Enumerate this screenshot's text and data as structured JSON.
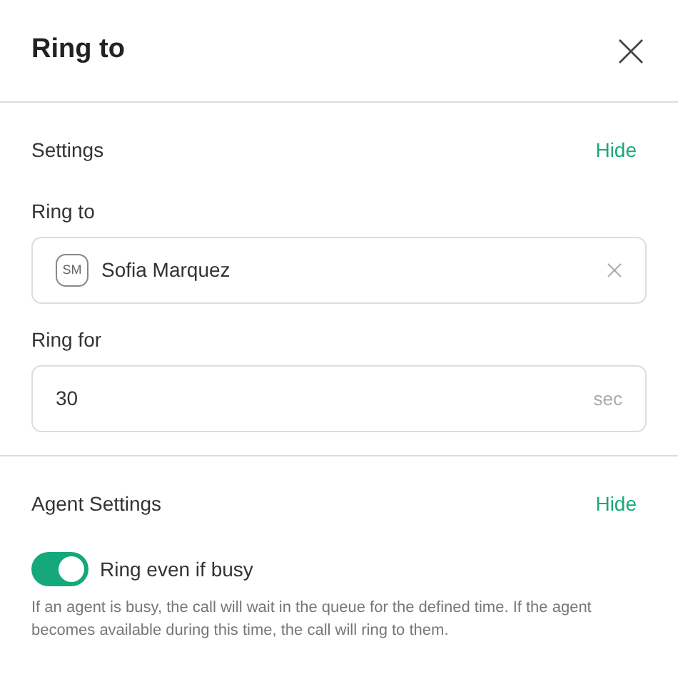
{
  "window": {
    "title": "Ring to"
  },
  "sections": [
    {
      "title": "Settings",
      "action": "Hide",
      "fields": [
        {
          "kind": "contact",
          "label": "Ring to",
          "avatar": "SM",
          "value": "Sofia Marquez"
        },
        {
          "kind": "number",
          "label": "Ring for",
          "value": "30",
          "unit": "sec"
        }
      ]
    },
    {
      "title": "Agent Settings",
      "action": "Hide",
      "toggles": [
        {
          "label": "Ring even if busy",
          "on": true,
          "description": "If an agent is busy, the call will wait in the queue for the defined time. If the agent becomes available during this time, the call will ring to them."
        }
      ]
    }
  ]
}
